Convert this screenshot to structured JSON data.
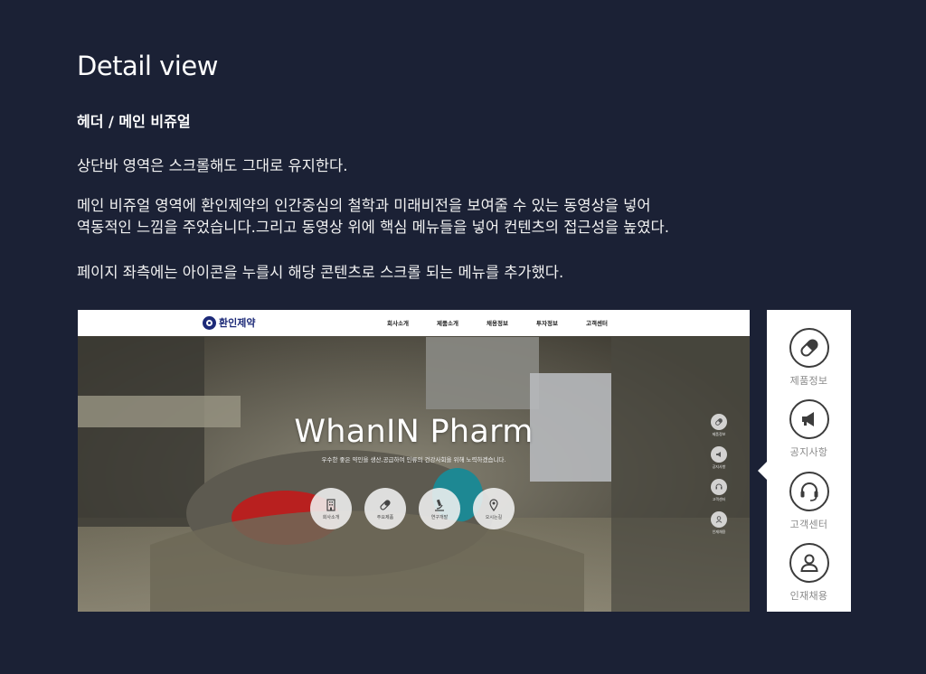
{
  "page": {
    "title": "Detail view",
    "section_title": "헤더 / 메인 비쥬얼",
    "paragraphs": [
      [
        "상단바 영역은 스크롤해도 그대로 유지한다."
      ],
      [
        "메인 비쥬얼 영역에 환인제약의 인간중심의 철학과 미래비전을 보여줄 수 있는 동영상을 넣어",
        "역동적인 느낌을 주었습니다.그리고 동영상 위에 핵심 메뉴들을 넣어 컨텐츠의 접근성을 높였다."
      ],
      [
        "페이지 좌측에는 아이콘을 누를시 해당 콘텐츠로 스크롤 되는  메뉴를 추가했다."
      ]
    ]
  },
  "preview": {
    "logo_text": "환인제약",
    "nav": [
      "회사소개",
      "제품소개",
      "채용정보",
      "투자정보",
      "고객센터"
    ],
    "hero_title": "WhanIN Pharm",
    "hero_subtitle": "우수한 좋은 약인을 생산,공급하여 인류의 건강사회을 위해 노력하겠습니다.",
    "hero_buttons": [
      {
        "label": "회사소개",
        "icon": "building-icon"
      },
      {
        "label": "주요제품",
        "icon": "capsule-icon"
      },
      {
        "label": "연구개발",
        "icon": "microscope-icon"
      },
      {
        "label": "오시는길",
        "icon": "map-pin-icon"
      }
    ],
    "mini_quick": [
      "제품정보",
      "공지사항",
      "고객센터",
      "인재채용"
    ]
  },
  "quick_menu": [
    {
      "label": "제품정보",
      "icon": "capsule-icon"
    },
    {
      "label": "공지사항",
      "icon": "megaphone-icon"
    },
    {
      "label": "고객센터",
      "icon": "headset-icon"
    },
    {
      "label": "인재채용",
      "icon": "person-icon"
    }
  ],
  "colors": {
    "background": "#1b2135",
    "logo_navy": "#1d2a78",
    "panel": "#ffffff",
    "quick_label": "#8a8a8a",
    "hero_red": "#c21a1a",
    "hero_teal": "#1d8893"
  }
}
